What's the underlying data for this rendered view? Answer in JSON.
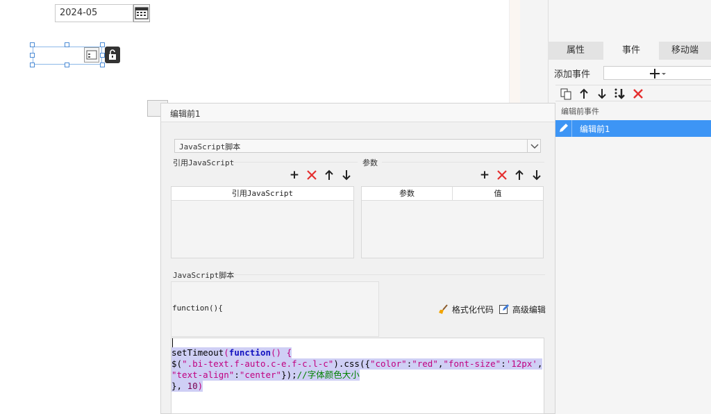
{
  "canvas": {
    "date_value": "2024-05"
  },
  "panel": {
    "tabs": [
      {
        "label": "属性",
        "active": false
      },
      {
        "label": "事件",
        "active": true
      },
      {
        "label": "移动端",
        "active": false
      }
    ],
    "add_event_label": "添加事件",
    "event_group": "编辑前事件",
    "events": [
      {
        "label": "编辑前1",
        "selected": true
      }
    ]
  },
  "dialog": {
    "title": "编辑前1",
    "type_select": "JavaScript脚本",
    "ref_section": "引用JavaScript",
    "param_section": "参数",
    "ref_table": {
      "columns": [
        "引用JavaScript"
      ]
    },
    "param_table": {
      "columns": [
        "参数",
        "值"
      ]
    },
    "script_section": "JavaScript脚本",
    "func_header": "function(){",
    "format_code": "格式化代码",
    "advanced_edit": "高级编辑",
    "code": {
      "line1_kw_a": "setTimeout",
      "line1_kw_b": "function",
      "line1_rest": "() {",
      "line2_pre": "$(",
      "line2_sel": "\".bi-text.f-auto.c-e.f-c.l-c\"",
      "line2_css": ").css({",
      "line2_k1": "\"color\"",
      "line2_v1": "\"red\"",
      "line2_k2": "\"font-size\"",
      "line2_v2": "'12px'",
      "line3_k3": "\"text-align\"",
      "line3_v3": "\"center\"",
      "line3_close": "});",
      "line3_comment": "//字体颜色大小",
      "line4_close": "}, ",
      "line4_num": "10",
      "line4_end": ")"
    }
  },
  "colors": {
    "accent": "#3d95f5",
    "danger": "#e53030",
    "code_selection": "#cfcff5"
  }
}
